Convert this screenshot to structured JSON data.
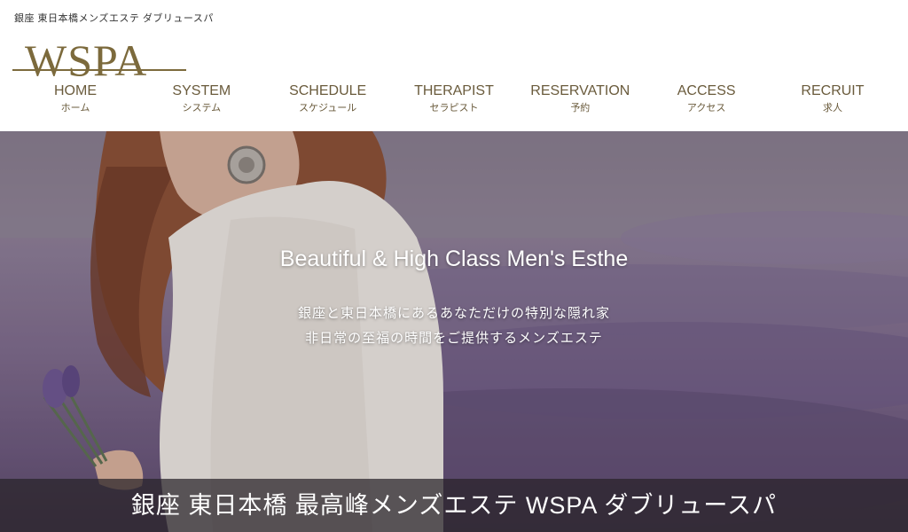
{
  "logo": {
    "tagline": "銀座 東日本橋メンズエステ ダブリュースパ",
    "wordmark": "WSPA"
  },
  "nav": {
    "items": [
      {
        "en": "HOME",
        "ja": "ホーム"
      },
      {
        "en": "SYSTEM",
        "ja": "システム"
      },
      {
        "en": "SCHEDULE",
        "ja": "スケジュール"
      },
      {
        "en": "THERAPIST",
        "ja": "セラピスト"
      },
      {
        "en": "RESERVATION",
        "ja": "予約"
      },
      {
        "en": "ACCESS",
        "ja": "アクセス"
      },
      {
        "en": "RECRUIT",
        "ja": "求人"
      }
    ]
  },
  "hero": {
    "title": "Beautiful & High Class Men's Esthe",
    "line1": "銀座と東日本橋にあるあなただけの特別な隠れ家",
    "line2": "非日常の至福の時間をご提供するメンズエステ",
    "image": "woman-in-lavender-field-photo"
  },
  "footer_bar": {
    "text": "銀座 東日本橋 最高峰メンズエステ WSPA ダブリュースパ"
  },
  "colors": {
    "brand_gold": "#7c6a3c",
    "nav_text": "#6a5b3c",
    "lavender": "#8d7f96"
  }
}
